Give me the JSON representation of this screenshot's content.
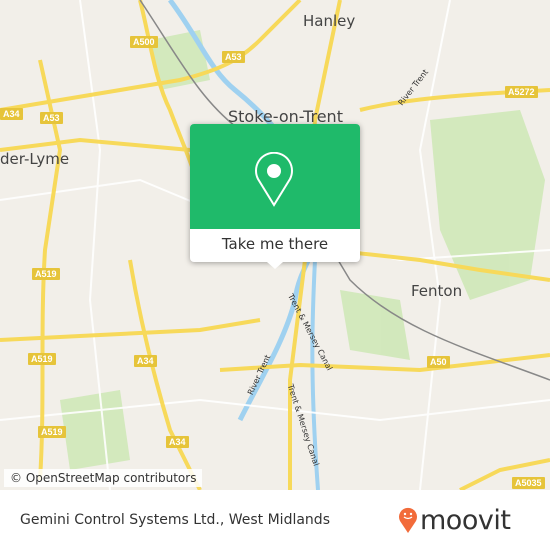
{
  "map": {
    "towns": [
      "Hanley",
      "Stoke-on-Trent",
      "Fenton",
      "der-Lyme"
    ],
    "roads": [
      "A500",
      "A53",
      "A34",
      "A53",
      "A5272",
      "A519",
      "A519",
      "A34",
      "A34",
      "A50",
      "A519",
      "A5035"
    ],
    "waterways": [
      "River Trent",
      "River Trent",
      "Trent & Mersey Canal",
      "Trent & Mersey Canal"
    ],
    "attribution": "© OpenStreetMap contributors",
    "colors": {
      "road_major": "#f7d95a",
      "water": "#9fd1f0",
      "park": "#cfe8b8",
      "land": "#f2efe9"
    }
  },
  "popup": {
    "icon": "location-pin-icon",
    "button_label": "Take me there",
    "color": "#1fba6a"
  },
  "footer": {
    "place_name": "Gemini Control Systems Ltd., West Midlands",
    "logo_text": "moovit",
    "logo_color": "#f26b3a"
  }
}
